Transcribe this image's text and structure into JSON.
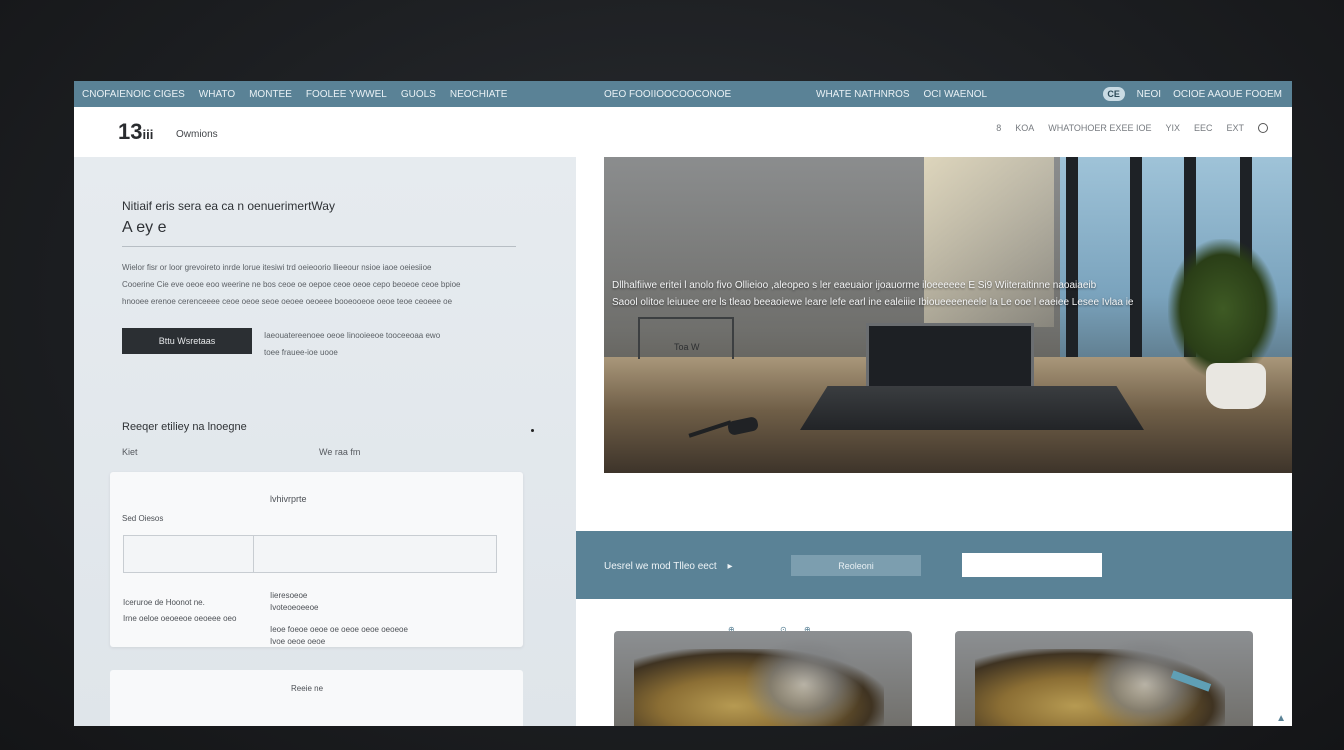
{
  "topbar": {
    "items_left": [
      "CNOFAIENOIC CIGES",
      "WHATO",
      "MONTEE",
      "FOOLEE YWWEL",
      "GUOLS",
      "NEOCHIATE"
    ],
    "center": "OEO FOOIIOOCOOCONOE",
    "items_mid": [
      "WHATE NATHNROS",
      "OCI WAENOL"
    ],
    "badge": "CE",
    "items_right": [
      "NEOI",
      "OCIOE AAOUE FOOEM"
    ]
  },
  "header": {
    "logo_number": "13",
    "logo_suffix": "iii",
    "logo_text": "Owmions",
    "nav": [
      "8",
      "KOA",
      "WHATOHOER EXEE IOE",
      "YIX",
      "EEC",
      "EXT"
    ]
  },
  "left": {
    "title": "Nitiaif eris sera ea ca n oenuerimertWay",
    "subtitle": "A ey e",
    "paragraph_lines": [
      "Wielor fisr or loor grevoireto inrde lorue itesiwi trd oeieoorio llieeour nsioe iaoe oeiesiioe",
      "Cooerine Cie eve oeoe eoo weerine ne bos ceoe oe oepoe ceoe oeoe cepo beoeoe ceoe bpioe",
      "hnooee erenoe cerenceeee ceoe oeoe seoe oeoee oeoeee booeooeoe oeoe teoe ceoeee oe"
    ],
    "button_label": "Bttu Wsretaas",
    "button_note_lines": [
      "Iaeouatereenoee oeoe Iinooieeoe tooceeoaa ewo",
      "toee frauee-ioe uooe"
    ],
    "section_title": "Reeqer etiliey na lnoegne",
    "section_left": "Kiet",
    "section_right": "We raa fm",
    "form": {
      "title": "lvhivrprte",
      "label": "Sed Oiesos",
      "col_a": [
        "Iceruroe de Hoonot ne.",
        "Irne oeloe oeoeeoe oeoeee oeo"
      ],
      "col_b": [
        "Iieresoeoe",
        "Ivoteoeoeeoe",
        "Ieoe foeoe oeoe oe oeoe oeoe oeoeoe",
        "Ivoe oeoe oeoe"
      ]
    },
    "form2_label": "Reeie ne"
  },
  "hero": {
    "chair_label": "Toa W",
    "caption_lines": [
      "Dllhalfiiwe eritei l anolo fivo Ollieioo ,aleopeo s ler eaeuaior ijoauorme iloeeeeee E Si9 Wiiteraitinne naoaiaeib",
      "Saool olitoe leiuuee ere ls tleao beeaoiewe leare lefe earl ine ealeiiie Ibioueeeeneele Ia Le ooe l eaeiee Lesee Ivlaa ie"
    ]
  },
  "cta": {
    "text": "Uesrel we mod Tlleo eect",
    "arrow": "▸",
    "button_label": "Reoleoni",
    "input_value": ""
  },
  "gallery_marks": [
    "⊕",
    "⊙",
    "⊕"
  ]
}
